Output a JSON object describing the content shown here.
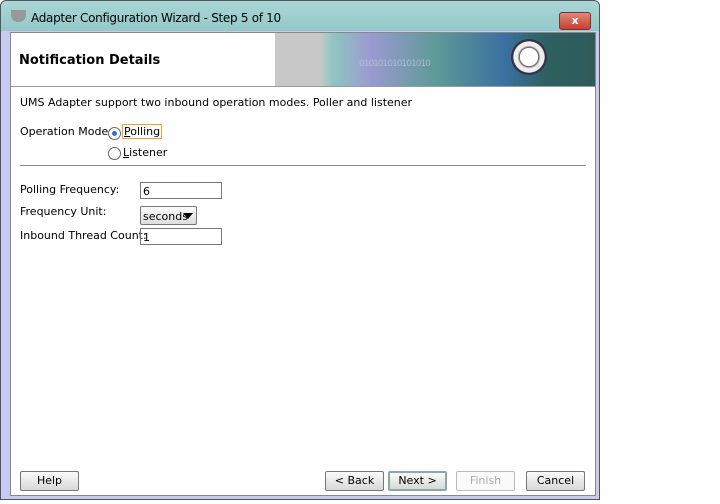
{
  "window": {
    "title": "Adapter Configuration Wizard - Step 5 of 10",
    "close_label": "x"
  },
  "header": {
    "title": "Notification Details",
    "banner_text": "010101010101010"
  },
  "description": "UMS Adapter support two inbound operation modes. Poller and listener",
  "operation_mode": {
    "label": "Operation Mode:",
    "options": [
      {
        "label": "Polling",
        "selected": true
      },
      {
        "label": "Listener",
        "selected": false
      }
    ]
  },
  "fields": {
    "polling_frequency": {
      "label": "Polling Frequency:",
      "value": "6"
    },
    "frequency_unit": {
      "label": "Frequency Unit:",
      "value": "seconds"
    },
    "inbound_thread_count": {
      "label": "Inbound Thread Count:",
      "value": "1"
    }
  },
  "buttons": {
    "help": "Help",
    "back": "< Back",
    "next": "Next >",
    "finish": "Finish",
    "cancel": "Cancel"
  }
}
